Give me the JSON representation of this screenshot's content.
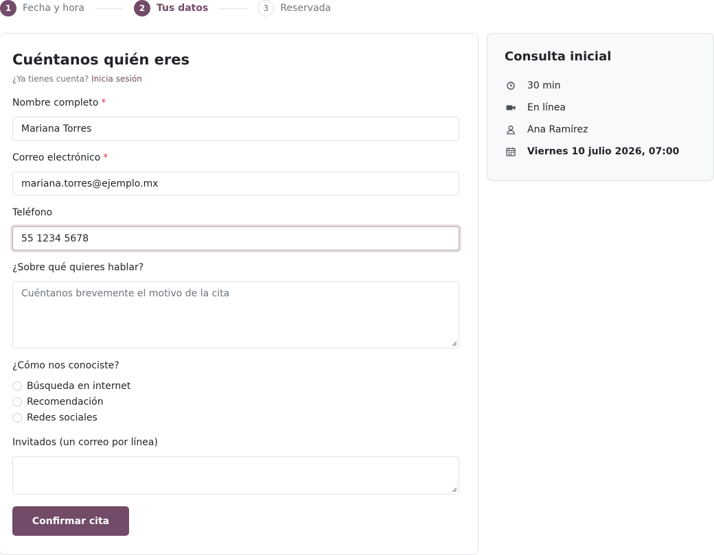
{
  "stepper": {
    "steps": [
      {
        "num": "1",
        "label": "Fecha y hora",
        "state": "done"
      },
      {
        "num": "2",
        "label": "Tus datos",
        "state": "active"
      },
      {
        "num": "3",
        "label": "Reservada",
        "state": "todo"
      }
    ]
  },
  "form": {
    "title": "Cuéntanos quién eres",
    "login_prompt": "¿Ya tienes cuenta?",
    "login_link": "Inicia sesión",
    "required_mark": "*",
    "name": {
      "label": "Nombre completo",
      "value": "Mariana Torres"
    },
    "email": {
      "label": "Correo electrónico",
      "value": "mariana.torres@ejemplo.mx"
    },
    "phone": {
      "label": "Teléfono",
      "value": "55 1234 5678"
    },
    "topic": {
      "label": "¿Sobre qué quieres hablar?",
      "placeholder": "Cuéntanos brevemente el motivo de la cita"
    },
    "source": {
      "label": "¿Cómo nos conociste?",
      "options": [
        "Búsqueda en internet",
        "Recomendación",
        "Redes sociales"
      ]
    },
    "guests": {
      "label": "Invitados (un correo por línea)",
      "value": ""
    },
    "submit_label": "Confirmar cita"
  },
  "summary": {
    "title": "Consulta inicial",
    "duration": "30 min",
    "location": "En línea",
    "host": "Ana Ramírez",
    "datetime": "Viernes 10 julio 2026, 07:00"
  },
  "colors": {
    "accent": "#714b67",
    "required": "#dc3545",
    "muted": "#6c757d",
    "border": "#dee2e6",
    "summary_bg": "#f8f9fa"
  }
}
